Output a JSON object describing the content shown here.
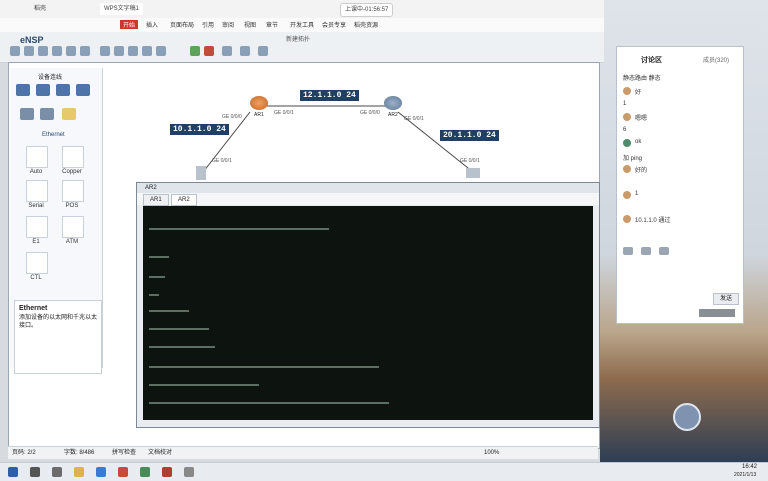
{
  "window_tabs": [
    "稻壳",
    "WPS文字稿1"
  ],
  "top_center": "上课中-01:56:57",
  "menu": [
    "开始",
    "插入",
    "页面布局",
    "引用",
    "审阅",
    "视图",
    "章节",
    "开发工具",
    "会员专享",
    "稻壳资源"
  ],
  "toolbar_title": "新建拓扑",
  "app_name": "eNSP",
  "device_panel": {
    "title": "设备连线",
    "section": "Ethernet",
    "cables": [
      "Auto",
      "Copper",
      "Serial",
      "POS",
      "E1",
      "ATM",
      "CTL"
    ]
  },
  "description": {
    "title": "Ethernet",
    "text": "添加设备的以太网和千兆以太接口。"
  },
  "topology": {
    "networks": [
      "10.1.1.0 24",
      "12.1.1.0 24",
      "20.1.1.0 24"
    ],
    "routers": [
      "AR1",
      "AR2"
    ],
    "ports": [
      "GE 0/0/1",
      "GE 0/0/0",
      "GE 0/0/0",
      "GE 0/0/1",
      "GE 0/0/1",
      "GE 0/0/1"
    ]
  },
  "terminal": {
    "title": "AR2",
    "tabs": [
      "AR1",
      "AR2"
    ]
  },
  "statusbar": {
    "left": "页码: 2/2",
    "words": "字数: 8/486",
    "mode": "拼写检查",
    "doc": "文档校对",
    "zoom": "100%"
  },
  "chat": {
    "title": "讨论区",
    "count": "成员(320)",
    "messages": [
      "静态路由 静态",
      "好",
      "1",
      "嗯嗯",
      "6",
      "ok",
      "好的",
      "1",
      "10.1.1.0 通过",
      "加 ping",
      "发送"
    ]
  },
  "tray": {
    "time": "16:42",
    "date": "2021/1/13"
  }
}
